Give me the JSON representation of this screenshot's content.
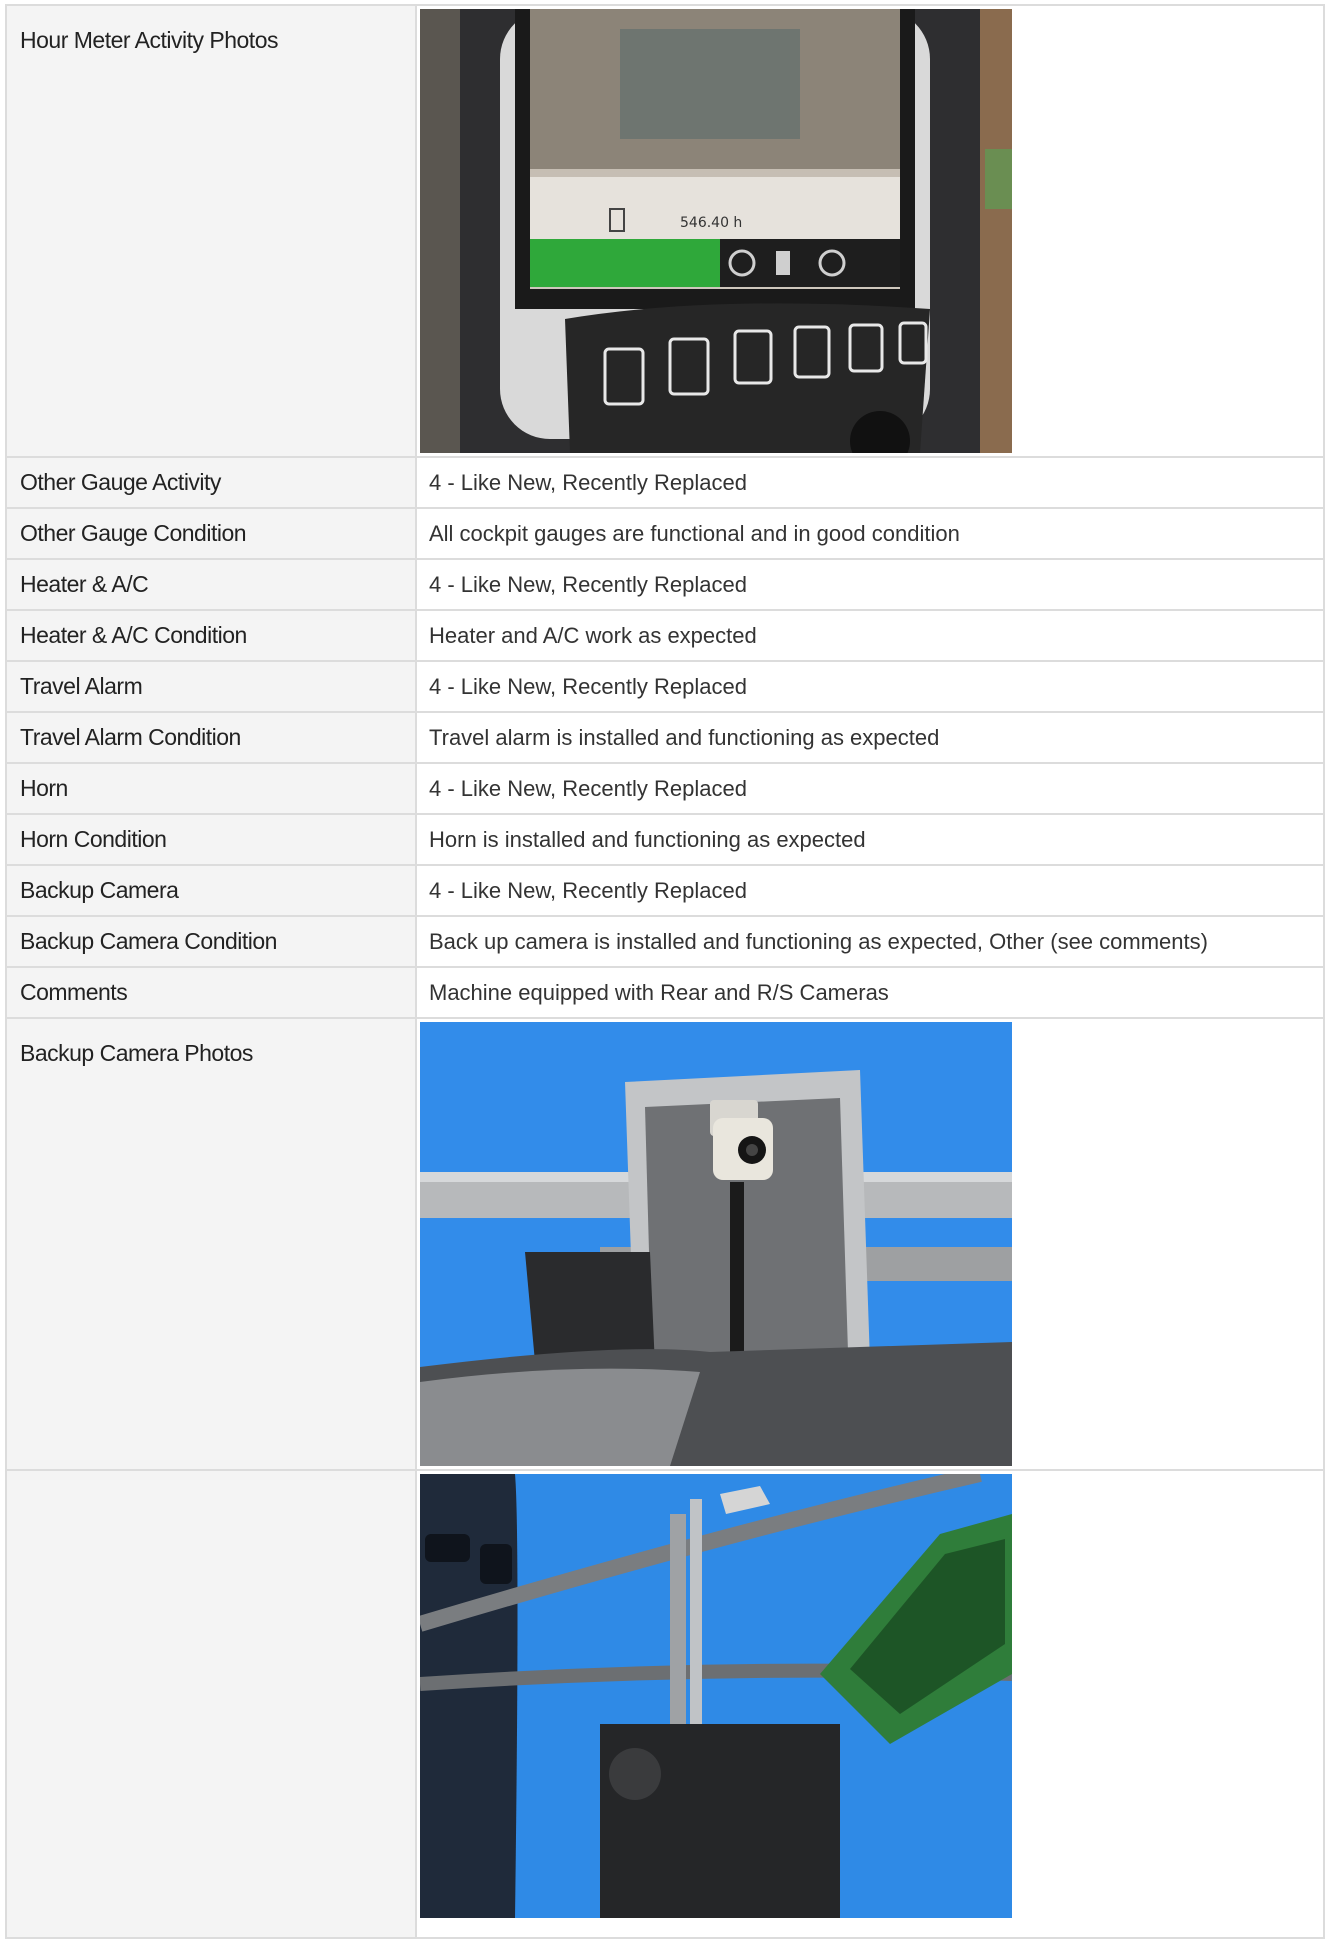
{
  "rows": [
    {
      "label": "Hour Meter Activity Photos",
      "type": "photo",
      "photo": "hour-meter-display-photo",
      "display_reading": "546.40 h"
    },
    {
      "label": "Other Gauge Activity",
      "value": "4 - Like New, Recently Replaced"
    },
    {
      "label": "Other Gauge Condition",
      "value": "All cockpit gauges are functional and in good condition"
    },
    {
      "label": "Heater & A/C",
      "value": "4 - Like New, Recently Replaced"
    },
    {
      "label": "Heater & A/C Condition",
      "value": "Heater and A/C work as expected"
    },
    {
      "label": "Travel Alarm",
      "value": "4 - Like New, Recently Replaced"
    },
    {
      "label": "Travel Alarm Condition",
      "value": "Travel alarm is installed and functioning as expected"
    },
    {
      "label": "Horn",
      "value": "4 - Like New, Recently Replaced"
    },
    {
      "label": "Horn Condition",
      "value": "Horn is installed and functioning as expected"
    },
    {
      "label": "Backup Camera",
      "value": "4 - Like New, Recently Replaced"
    },
    {
      "label": "Backup Camera Condition",
      "value": "Back up camera is installed and functioning as expected, Other (see comments)"
    },
    {
      "label": "Comments",
      "value": "Machine equipped with Rear and R/S Cameras"
    },
    {
      "label": "Backup Camera Photos",
      "type": "photo",
      "photo": "backup-camera-photo"
    },
    {
      "label": "",
      "type": "photo",
      "photo": "side-camera-photo"
    }
  ]
}
